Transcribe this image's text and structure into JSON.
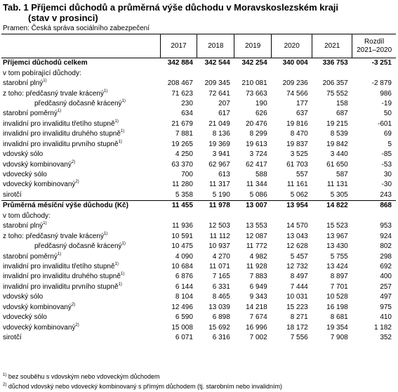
{
  "title_line1": "Tab. 1 Příjemci důchodů a průměrná výše důchodu v Moravskoslezském kraji",
  "title_line2": "(stav v prosinci)",
  "source": "Pramen: Česká správa sociálního zabezpečení",
  "columns": [
    "2017",
    "2018",
    "2019",
    "2020",
    "2021",
    "Rozdíl",
    "2021–2020"
  ],
  "rows": [
    {
      "label": "Příjemci důchodů celkem",
      "note": "",
      "cls": "bold",
      "values": [
        "342 884",
        "342 544",
        "342 254",
        "340 004",
        "336 753",
        "-3 251"
      ]
    },
    {
      "label": "v tom pobírající důchody:",
      "note": "",
      "cls": "",
      "values": [
        "",
        "",
        "",
        "",
        "",
        ""
      ]
    },
    {
      "label": "starobní plný",
      "note": "1)",
      "cls": "",
      "values": [
        "208 467",
        "209 345",
        "210 081",
        "209 236",
        "206 357",
        "-2 879"
      ]
    },
    {
      "label": "z toho: předčasný trvale krácený",
      "note": "1)",
      "cls": "",
      "values": [
        "71 623",
        "72 641",
        "73 663",
        "74 566",
        "75 552",
        "986"
      ]
    },
    {
      "label": "předčasný dočasně krácený",
      "note": "1)",
      "cls": "ind2",
      "values": [
        "230",
        "207",
        "190",
        "177",
        "158",
        "-19"
      ]
    },
    {
      "label": "starobní poměrný",
      "note": "1)",
      "cls": "",
      "values": [
        "634",
        "617",
        "626",
        "637",
        "687",
        "50"
      ]
    },
    {
      "label": "invalidní pro invaliditu třetího stupně",
      "note": "1)",
      "cls": "",
      "values": [
        "21 679",
        "21 049",
        "20 476",
        "19 816",
        "19 215",
        "-601"
      ]
    },
    {
      "label": "invalidní pro invaliditu druhého stupně",
      "note": "1)",
      "cls": "",
      "values": [
        "7 881",
        "8 136",
        "8 299",
        "8 470",
        "8 539",
        "69"
      ]
    },
    {
      "label": "invalidní pro invaliditu prvního stupně",
      "note": "1)",
      "cls": "",
      "values": [
        "19 265",
        "19 369",
        "19 613",
        "19 837",
        "19 842",
        "5"
      ]
    },
    {
      "label": "vdovský sólo",
      "note": "",
      "cls": "",
      "values": [
        "4 250",
        "3 941",
        "3 724",
        "3 525",
        "3 440",
        "-85"
      ]
    },
    {
      "label": "vdovský kombinovaný",
      "note": "2)",
      "cls": "",
      "values": [
        "63 370",
        "62 967",
        "62 417",
        "61 703",
        "61 650",
        "-53"
      ]
    },
    {
      "label": "vdovecký sólo",
      "note": "",
      "cls": "",
      "values": [
        "700",
        "613",
        "588",
        "557",
        "587",
        "30"
      ]
    },
    {
      "label": "vdovecký kombinovaný",
      "note": "2)",
      "cls": "",
      "values": [
        "11 280",
        "11 317",
        "11 344",
        "11 161",
        "11 131",
        "-30"
      ]
    },
    {
      "label": "sirotčí",
      "note": "",
      "cls": "",
      "values": [
        "5 358",
        "5 190",
        "5 086",
        "5 062",
        "5 305",
        "243"
      ]
    },
    {
      "label": "Průměrná měsíční výše důchodu (Kč)",
      "note": "",
      "cls": "bold",
      "values": [
        "11 455",
        "11 978",
        "13 007",
        "13 954",
        "14 822",
        "868"
      ]
    },
    {
      "label": "v tom důchody:",
      "note": "",
      "cls": "",
      "values": [
        "",
        "",
        "",
        "",
        "",
        ""
      ]
    },
    {
      "label": "starobní plný",
      "note": "1)",
      "cls": "",
      "values": [
        "11 936",
        "12 503",
        "13 553",
        "14 570",
        "15 523",
        "953"
      ]
    },
    {
      "label": "z toho: předčasný trvale krácený",
      "note": "1)",
      "cls": "",
      "values": [
        "10 591",
        "11 112",
        "12 087",
        "13 043",
        "13 967",
        "924"
      ]
    },
    {
      "label": "předčasný dočasně krácený",
      "note": "1)",
      "cls": "ind2",
      "values": [
        "10 475",
        "10 937",
        "11 772",
        "12 628",
        "13 430",
        "802"
      ]
    },
    {
      "label": "starobní poměrný",
      "note": "1)",
      "cls": "",
      "values": [
        "4 090",
        "4 270",
        "4 982",
        "5 457",
        "5 755",
        "298"
      ]
    },
    {
      "label": "invalidní pro invaliditu třetího stupně",
      "note": "1)",
      "cls": "",
      "values": [
        "10 684",
        "11 071",
        "11 928",
        "12 732",
        "13 424",
        "692"
      ]
    },
    {
      "label": "invalidní pro invaliditu druhého stupně",
      "note": "1)",
      "cls": "",
      "values": [
        "6 876",
        "7 165",
        "7 883",
        "8 497",
        "8 897",
        "400"
      ]
    },
    {
      "label": "invalidní pro invaliditu prvního stupně",
      "note": "1)",
      "cls": "",
      "values": [
        "6 144",
        "6 331",
        "6 949",
        "7 444",
        "7 701",
        "257"
      ]
    },
    {
      "label": "vdovský sólo",
      "note": "",
      "cls": "",
      "values": [
        "8 104",
        "8 465",
        "9 343",
        "10 031",
        "10 528",
        "497"
      ]
    },
    {
      "label": "vdovský kombinovaný",
      "note": "2)",
      "cls": "",
      "values": [
        "12 496",
        "13 039",
        "14 218",
        "15 223",
        "16 198",
        "975"
      ]
    },
    {
      "label": "vdovecký sólo",
      "note": "",
      "cls": "",
      "values": [
        "6 590",
        "6 898",
        "7 674",
        "8 271",
        "8 681",
        "410"
      ]
    },
    {
      "label": "vdovecký kombinovaný",
      "note": "2)",
      "cls": "",
      "values": [
        "15 008",
        "15 692",
        "16 996",
        "18 172",
        "19 354",
        "1 182"
      ]
    },
    {
      "label": "sirotčí",
      "note": "",
      "cls": "",
      "values": [
        "6 071",
        "6 316",
        "7 002",
        "7 556",
        "7 908",
        "352"
      ]
    }
  ],
  "notes": [
    {
      "mark": "1)",
      "text": "bez souběhu s vdovským nebo vdoveckým důchodem"
    },
    {
      "mark": "2)",
      "text": "důchod vdovský nebo vdovecký kombinovaný s přímým důchodem (tj. starobním nebo invalidním)"
    }
  ]
}
